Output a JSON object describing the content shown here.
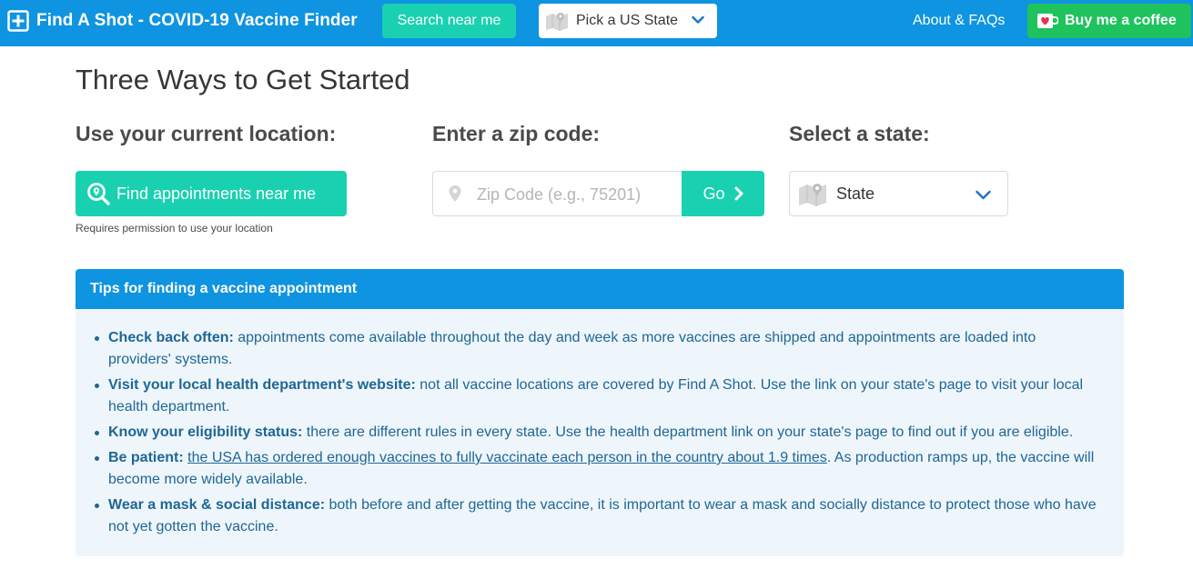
{
  "nav": {
    "brand_icon": "plus-square-icon",
    "brand_title": "Find A Shot - COVID-19 Vaccine Finder",
    "search_label": "Search near me",
    "state_select_label": "Pick a US State",
    "about_label": "About & FAQs",
    "coffee_icon": "coffee-heart-icon",
    "coffee_label": "Buy me a coffee",
    "colors": {
      "navbar": "#0e94e0",
      "accent_teal": "#19d1b0",
      "coffee_green": "#1fc35d"
    }
  },
  "main": {
    "title": "Three Ways to Get Started",
    "location": {
      "heading": "Use your current location:",
      "button_icon": "location-search-icon",
      "button_label": "Find appointments near me",
      "help": "Requires permission to use your location"
    },
    "zip": {
      "heading": "Enter a zip code:",
      "input_icon": "map-pin-icon",
      "placeholder": "Zip Code (e.g., 75201)",
      "value": "",
      "go_label": "Go",
      "go_icon": "chevron-right-icon"
    },
    "state": {
      "heading": "Select a state:",
      "select_icon": "map-icon",
      "selected": "State"
    }
  },
  "tips": {
    "header": "Tips for finding a vaccine appointment",
    "items": [
      {
        "title": "Check back often:",
        "text": " appointments come available throughout the day and week as more vaccines are shipped and appointments are loaded into providers' systems."
      },
      {
        "title": "Visit your local health department's website:",
        "text": " not all vaccine locations are covered by Find A Shot. Use the link on your state's page to visit your local health department."
      },
      {
        "title": "Know your eligibility status:",
        "text": " there are different rules in every state. Use the health department link on your state's page to find out if you are eligible."
      },
      {
        "title": "Be patient:",
        "link": "the USA has ordered enough vaccines to fully vaccinate each person in the country about 1.9 times",
        "text": ". As production ramps up, the vaccine will become more widely available."
      },
      {
        "title": "Wear a mask & social distance:",
        "text": " both before and after getting the vaccine, it is important to wear a mask and socially distance to protect those who have not yet gotten the vaccine."
      }
    ],
    "colors": {
      "background": "#eef6fc",
      "text": "#1f6694"
    }
  }
}
